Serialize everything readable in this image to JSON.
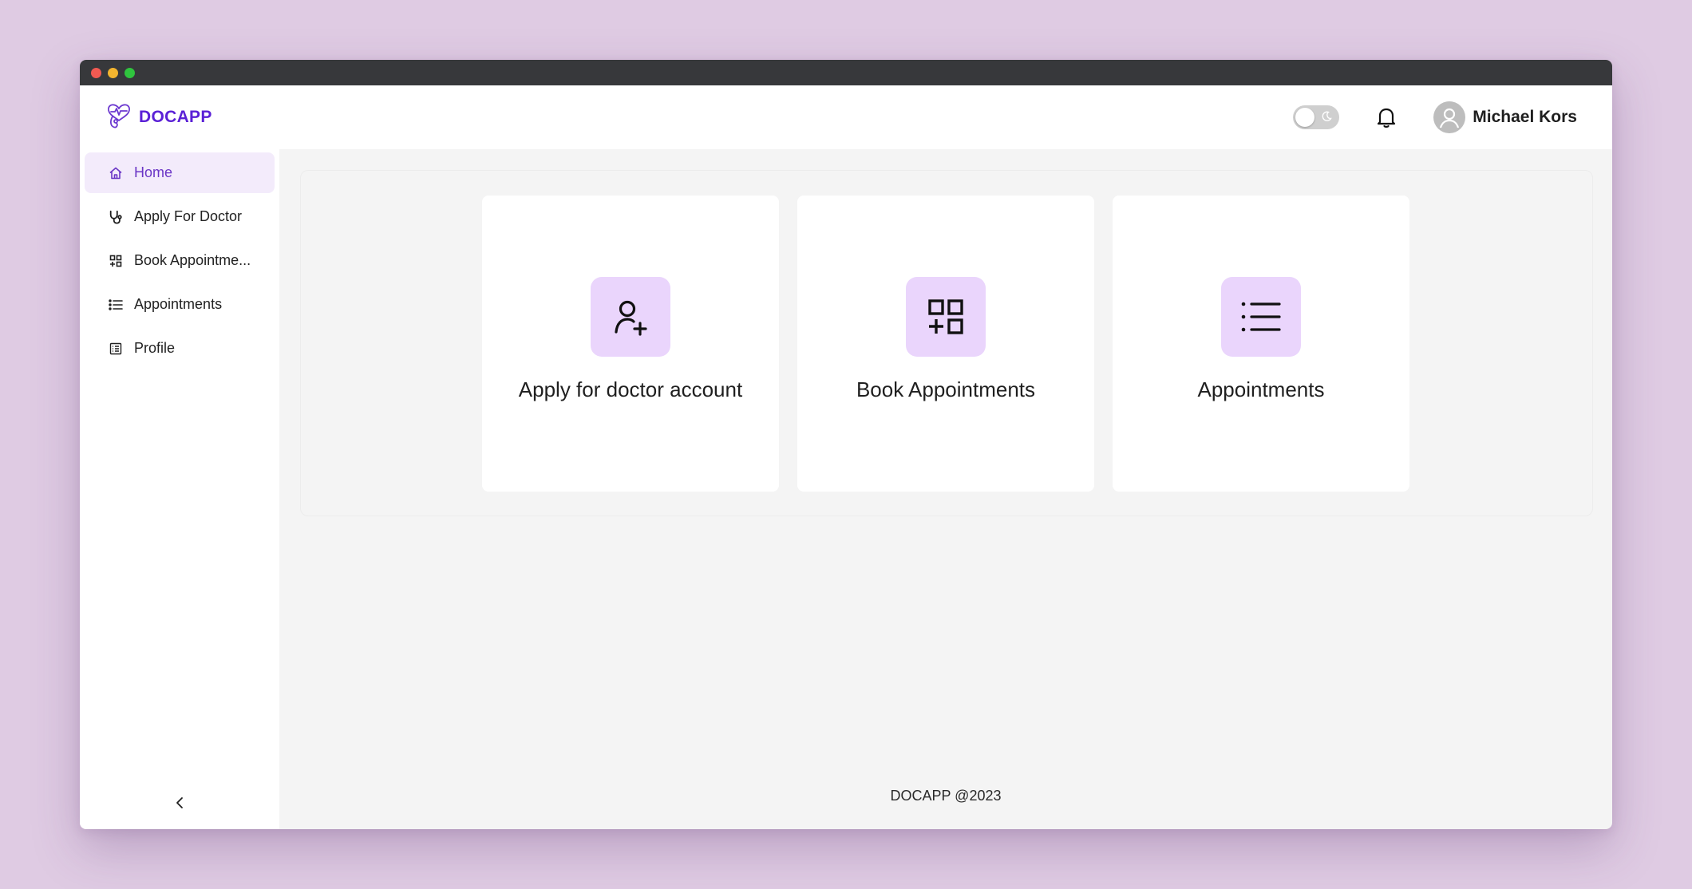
{
  "brand": {
    "name": "DOCAPP",
    "color": "#5b21d6",
    "icon": "heart-stethoscope-logo"
  },
  "header": {
    "theme_toggle": {
      "icon": "moon-icon",
      "state": "off"
    },
    "notification_icon": "bell-icon",
    "user": {
      "name": "Michael Kors",
      "avatar_icon": "user-avatar-icon"
    }
  },
  "sidebar": {
    "items": [
      {
        "label": "Home",
        "icon": "home-icon",
        "active": true
      },
      {
        "label": "Apply For Doctor",
        "icon": "stethoscope-icon",
        "active": false
      },
      {
        "label": "Book Appointme...",
        "icon": "grid-plus-icon",
        "active": false
      },
      {
        "label": "Appointments",
        "icon": "list-icon",
        "active": false
      },
      {
        "label": "Profile",
        "icon": "profile-card-icon",
        "active": false
      }
    ],
    "collapse_icon": "chevron-left-icon"
  },
  "cards": [
    {
      "title": "Apply for doctor account",
      "icon": "user-plus-icon"
    },
    {
      "title": "Book Appointments",
      "icon": "grid-plus-icon"
    },
    {
      "title": "Appointments",
      "icon": "list-icon"
    }
  ],
  "footer": {
    "text": "DOCAPP @2023"
  },
  "colors": {
    "accent": "#5b21d6",
    "active_nav_bg": "#f3ebfb",
    "card_icon_bg": "#ead5fc",
    "page_bg": "#dfcbe3"
  }
}
